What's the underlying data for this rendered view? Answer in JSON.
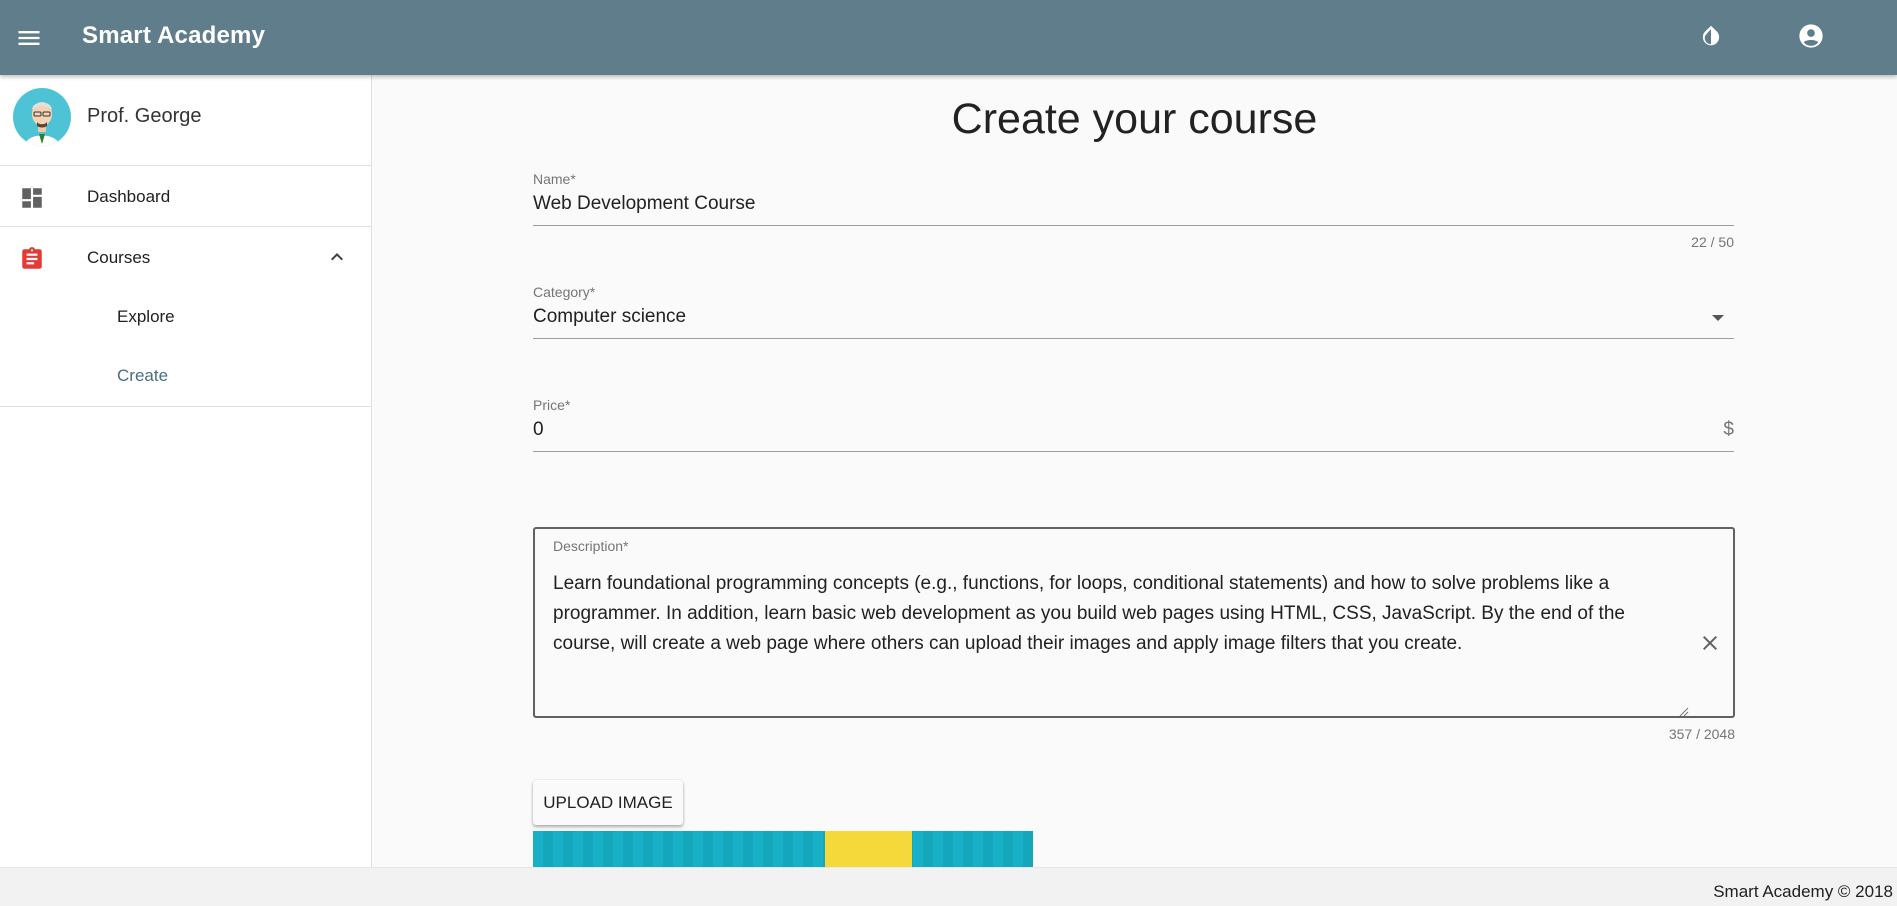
{
  "app": {
    "title": "Smart Academy"
  },
  "sidebar": {
    "profile_name": "Prof. George",
    "items": [
      {
        "label": "Dashboard",
        "icon": "dashboard-icon"
      },
      {
        "label": "Courses",
        "icon": "clipboard-icon",
        "expanded": true,
        "children": [
          {
            "label": "Explore"
          },
          {
            "label": "Create",
            "active": true
          }
        ]
      }
    ]
  },
  "main": {
    "page_title": "Create your course",
    "name_field": {
      "label": "Name*",
      "value": "Web Development Course",
      "counter": "22 / 50"
    },
    "category_field": {
      "label": "Category*",
      "value": "Computer science"
    },
    "price_field": {
      "label": "Price*",
      "value": "0",
      "suffix": "$"
    },
    "description_field": {
      "label": "Description*",
      "value": "Learn foundational programming concepts (e.g., functions, for loops, conditional statements) and how to solve problems like a programmer. In addition, learn basic web development as you build web pages using HTML, CSS, JavaScript. By the end of the course, will create a web page where others can upload their images and apply image filters that you create.",
      "counter": "357 / 2048"
    },
    "upload_button": "UPLOAD IMAGE"
  },
  "footer": {
    "text": "Smart Academy © 2018"
  },
  "colors": {
    "appbar": "#607d8b",
    "active_nav": "#48707f",
    "courses_icon": "#e53935"
  }
}
